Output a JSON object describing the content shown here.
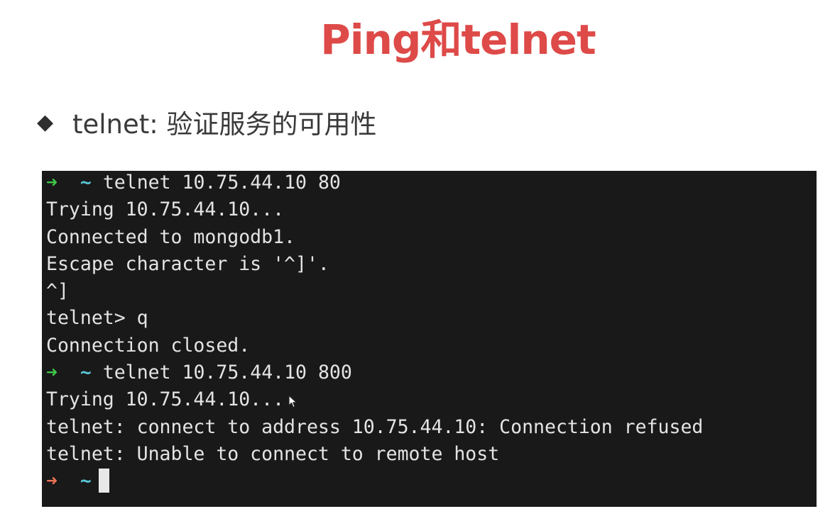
{
  "slide": {
    "title": "Ping和telnet",
    "bullet": "telnet: 验证服务的可用性"
  },
  "terminal": {
    "prompt_arrow": "➜",
    "prompt_dir": "~",
    "lines": [
      {
        "kind": "prompt",
        "status": "ok",
        "command": "telnet 10.75.44.10 80"
      },
      {
        "kind": "output",
        "text": "Trying 10.75.44.10..."
      },
      {
        "kind": "output",
        "text": "Connected to mongodb1."
      },
      {
        "kind": "output",
        "text": "Escape character is '^]'."
      },
      {
        "kind": "output",
        "text": "^]"
      },
      {
        "kind": "output",
        "text": "telnet> q"
      },
      {
        "kind": "output",
        "text": "Connection closed."
      },
      {
        "kind": "prompt",
        "status": "ok",
        "command": "telnet 10.75.44.10 800"
      },
      {
        "kind": "output",
        "text": "Trying 10.75.44.10..."
      },
      {
        "kind": "output",
        "text": "telnet: connect to address 10.75.44.10: Connection refused"
      },
      {
        "kind": "output",
        "text": "telnet: Unable to connect to remote host"
      },
      {
        "kind": "prompt",
        "status": "fail",
        "command": ""
      }
    ]
  },
  "colors": {
    "title": "#dd4a48",
    "terminal_bg": "#191919",
    "terminal_text": "#e4e4e4",
    "prompt_ok": "#3ec94a",
    "prompt_fail": "#f07355",
    "prompt_dir": "#57c6d8"
  },
  "icons": {
    "bullet": "diamond-bullet-icon",
    "prompt": "arrow-right-icon",
    "pointer": "mouse-pointer-icon"
  }
}
